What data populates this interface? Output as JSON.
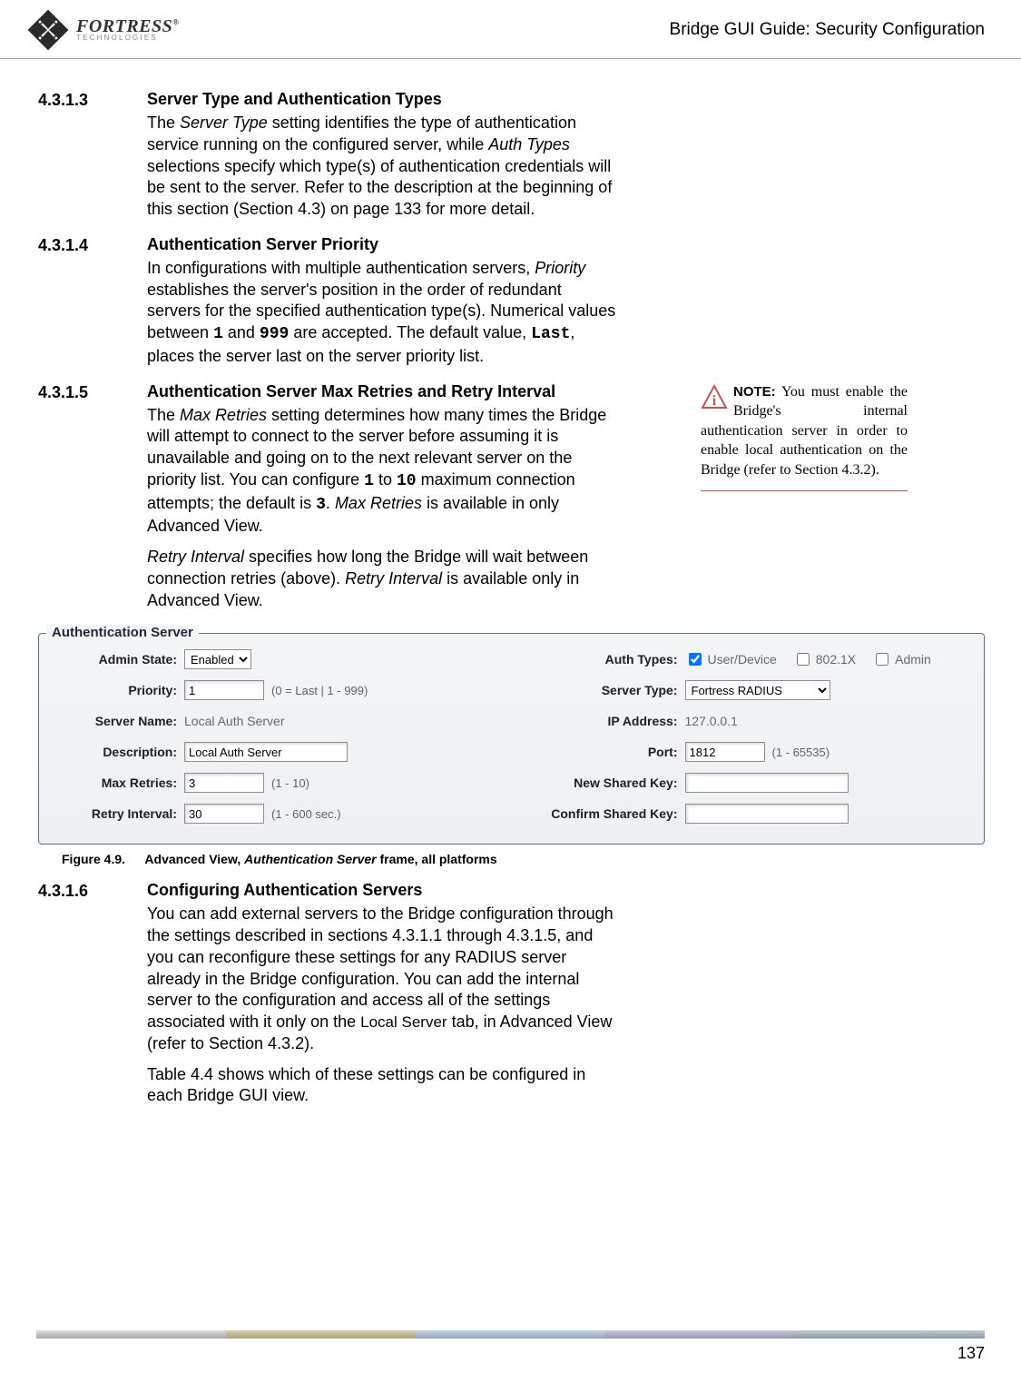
{
  "header": {
    "logo_main": "FORTRESS",
    "logo_reg": "®",
    "logo_sub": "TECHNOLOGIES",
    "doc_title": "Bridge GUI Guide: Security Configuration"
  },
  "sections": {
    "s1": {
      "num": "4.3.1.3",
      "title": "Server Type and Authentication Types",
      "p1a": "The ",
      "p1b": "Server Type",
      "p1c": " setting identifies the type of authentication service running on the configured server, while ",
      "p1d": "Auth Types",
      "p1e": " selections specify which type(s) of authentication credentials will be sent to the server. Refer to the description at the beginning of this section (Section 4.3) on page 133 for more detail."
    },
    "s2": {
      "num": "4.3.1.4",
      "title": "Authentication Server Priority",
      "p1a": "In configurations with multiple authentication servers, ",
      "p1b": "Priority",
      "p1c": " establishes the server's position in the order of redundant servers for the specified authentication type(s). Numerical values between ",
      "p1d": "1",
      "p1e": " and ",
      "p1f": "999",
      "p1g": " are accepted. The default value, ",
      "p1h": "Last",
      "p1i": ", places the server last on the server priority list."
    },
    "s3": {
      "num": "4.3.1.5",
      "title": "Authentication Server Max Retries and Retry Interval",
      "p1a": "The ",
      "p1b": "Max Retries",
      "p1c": " setting determines how many times the Bridge will attempt to connect to the server before assuming it is unavailable and going on to the next relevant server on the priority list. You can configure ",
      "p1d": "1",
      "p1e": " to ",
      "p1f": "10",
      "p1g": " maximum connection attempts; the default is ",
      "p1h": "3",
      "p1i": ". ",
      "p1j": "Max Retries",
      "p1k": " is available in only Advanced View.",
      "p2a": "Retry Interval",
      "p2b": " specifies how long the Bridge will wait between connection retries (above). ",
      "p2c": "Retry Interval",
      "p2d": " is available only in Advanced View."
    },
    "s4": {
      "num": "4.3.1.6",
      "title": "Configuring Authentication Servers",
      "p1": "You can add external servers to the Bridge configuration through the settings described in sections 4.3.1.1 through 4.3.1.5, and you can reconfigure these settings for any RADIUS server already in the Bridge configuration. You can add the internal server to the configuration and access all of the settings associated with it only on the ",
      "p1b": "Local Server",
      "p1c": " tab, in Advanced View (refer to Section 4.3.2).",
      "p2": "Table 4.4 shows which of these settings can be configured in each Bridge GUI view."
    }
  },
  "sidenote": {
    "prefix": "NOTE:",
    "body": " You must enable the Bridge's internal authentication server in order to enable local authentication on the Bridge (refer to Section 4.3.2)."
  },
  "figure": {
    "legend": "Authentication Server",
    "labels": {
      "admin_state": "Admin State:",
      "priority": "Priority:",
      "server_name": "Server Name:",
      "description": "Description:",
      "max_retries": "Max Retries:",
      "retry_interval": "Retry Interval:",
      "auth_types": "Auth Types:",
      "server_type": "Server Type:",
      "ip_address": "IP Address:",
      "port": "Port:",
      "new_shared_key": "New Shared Key:",
      "confirm_shared_key": "Confirm Shared Key:"
    },
    "values": {
      "admin_state": "Enabled",
      "priority": "1",
      "priority_hint": "(0 = Last | 1 - 999)",
      "server_name": "Local Auth Server",
      "description": "Local Auth Server",
      "max_retries": "3",
      "max_retries_hint": "(1 - 10)",
      "retry_interval": "30",
      "retry_interval_hint": "(1 - 600 sec.)",
      "auth_user_device": "User/Device",
      "auth_8021x": "802.1X",
      "auth_admin": "Admin",
      "server_type": "Fortress RADIUS",
      "ip_address": "127.0.0.1",
      "port": "1812",
      "port_hint": "(1 - 65535)"
    },
    "caption_num": "Figure 4.9.",
    "caption_a": "Advanced View, ",
    "caption_b": "Authentication Server",
    "caption_c": " frame, all platforms"
  },
  "footer": {
    "page": "137"
  }
}
